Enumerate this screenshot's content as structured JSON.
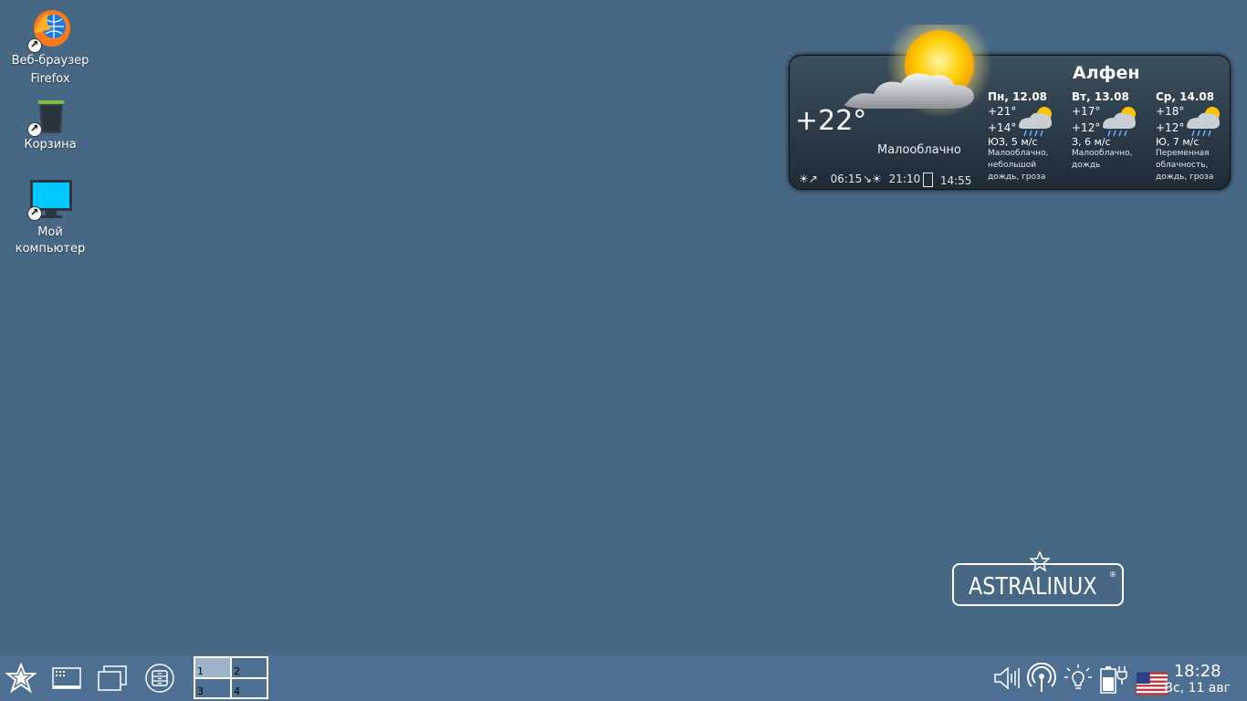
{
  "desktop": {
    "icons": [
      {
        "label_line1": "Веб-браузер",
        "label_line2": "Firefox",
        "icon": "firefox-icon"
      },
      {
        "label_line1": "Корзина",
        "label_line2": "",
        "icon": "trash-icon"
      },
      {
        "label_line1": "Мой",
        "label_line2": "компьютер",
        "icon": "computer-icon"
      }
    ]
  },
  "weather": {
    "city": "Алфен",
    "current_temp": "+22°",
    "condition": "Малооблачно",
    "sunrise": "06:15",
    "sunset": "21:10",
    "day_length": "14:55",
    "forecast": [
      {
        "day": "Пн, 12.08",
        "high": "+21°",
        "low": "+14°",
        "wind": "ЮЗ, 5 м/с",
        "desc": "Малооблачно, небольшой дождь, гроза"
      },
      {
        "day": "Вт, 13.08",
        "high": "+17°",
        "low": "+12°",
        "wind": "З, 6 м/с",
        "desc": "Малооблачно, дождь"
      },
      {
        "day": "Ср, 14.08",
        "high": "+18°",
        "low": "+12°",
        "wind": "Ю, 7 м/с",
        "desc": "Переменная облачность, дождь, гроза"
      }
    ]
  },
  "logo": {
    "text": "ASTRALINUX",
    "registered": "®"
  },
  "taskbar": {
    "pager": [
      "1",
      "2",
      "3",
      "4"
    ],
    "active_desktop": "1",
    "clock_time": "18:28",
    "clock_date": "Вс, 11 авг",
    "tray_icons": [
      "volume-icon",
      "network-icon",
      "brightness-icon",
      "battery-icon",
      "us-flag-icon"
    ]
  },
  "colors": {
    "desktop_bg": "#476885",
    "taskbar_bg": "#4d7092",
    "screen_cyan": "#00c8ff"
  }
}
